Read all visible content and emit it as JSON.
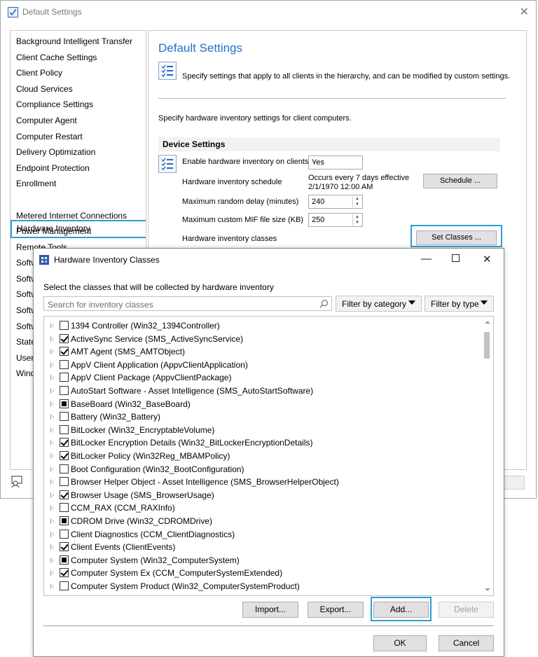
{
  "window": {
    "title": "Default Settings"
  },
  "sidebar": {
    "items": [
      "Background Intelligent Transfer",
      "Client Cache Settings",
      "Client Policy",
      "Cloud Services",
      "Compliance Settings",
      "Computer Agent",
      "Computer Restart",
      "Delivery Optimization",
      "Endpoint Protection",
      "Enrollment",
      "Hardware Inventory",
      "Metered Internet Connections",
      "Power Management",
      "Remote Tools",
      "Softw",
      "Softw",
      "Softw",
      "Softw",
      "Softw",
      "State",
      "User",
      "Wind"
    ],
    "selected": "Hardware Inventory"
  },
  "content": {
    "title": "Default Settings",
    "description": "Specify settings that apply to all clients in the hierarchy, and can be modified by custom settings.",
    "hw_description": "Specify hardware inventory settings for client computers.",
    "section": "Device Settings",
    "enable_label": "Enable hardware inventory on clients",
    "enable_value": "Yes",
    "schedule_label": "Hardware inventory schedule",
    "schedule_text_1": "Occurs every 7 days effective",
    "schedule_text_2": "2/1/1970 12:00 AM",
    "schedule_button": "Schedule ...",
    "delay_label": "Maximum random delay (minutes)",
    "delay_value": "240",
    "mif_label": "Maximum custom MIF file size (KB)",
    "mif_value": "250",
    "classes_label": "Hardware inventory classes",
    "set_classes_button": "Set Classes ..."
  },
  "dialog": {
    "title": "Hardware Inventory Classes",
    "instruction": "Select the classes that will be collected by hardware inventory",
    "search_placeholder": "Search for inventory classes",
    "filter_category": "Filter by category",
    "filter_type": "Filter by type",
    "classes": [
      {
        "label": "1394 Controller (Win32_1394Controller)",
        "state": "unchecked"
      },
      {
        "label": "ActiveSync Service (SMS_ActiveSyncService)",
        "state": "checked"
      },
      {
        "label": "AMT Agent (SMS_AMTObject)",
        "state": "checked"
      },
      {
        "label": "AppV Client Application (AppvClientApplication)",
        "state": "unchecked"
      },
      {
        "label": "AppV Client Package (AppvClientPackage)",
        "state": "unchecked"
      },
      {
        "label": "AutoStart Software - Asset Intelligence (SMS_AutoStartSoftware)",
        "state": "unchecked"
      },
      {
        "label": "BaseBoard (Win32_BaseBoard)",
        "state": "partial"
      },
      {
        "label": "Battery (Win32_Battery)",
        "state": "unchecked"
      },
      {
        "label": "BitLocker (Win32_EncryptableVolume)",
        "state": "unchecked"
      },
      {
        "label": "BitLocker Encryption Details (Win32_BitLockerEncryptionDetails)",
        "state": "checked"
      },
      {
        "label": "BitLocker Policy (Win32Reg_MBAMPolicy)",
        "state": "checked"
      },
      {
        "label": "Boot Configuration (Win32_BootConfiguration)",
        "state": "unchecked"
      },
      {
        "label": "Browser Helper Object - Asset Intelligence (SMS_BrowserHelperObject)",
        "state": "unchecked"
      },
      {
        "label": "Browser Usage (SMS_BrowserUsage)",
        "state": "checked"
      },
      {
        "label": "CCM_RAX (CCM_RAXInfo)",
        "state": "unchecked"
      },
      {
        "label": "CDROM Drive (Win32_CDROMDrive)",
        "state": "partial"
      },
      {
        "label": "Client Diagnostics (CCM_ClientDiagnostics)",
        "state": "unchecked"
      },
      {
        "label": "Client Events (ClientEvents)",
        "state": "checked"
      },
      {
        "label": "Computer System (Win32_ComputerSystem)",
        "state": "partial"
      },
      {
        "label": "Computer System Ex (CCM_ComputerSystemExtended)",
        "state": "checked"
      },
      {
        "label": "Computer System Product (Win32_ComputerSystemProduct)",
        "state": "unchecked"
      }
    ],
    "buttons": {
      "import": "Import...",
      "export": "Export...",
      "add": "Add...",
      "delete": "Delete",
      "ok": "OK",
      "cancel": "Cancel"
    }
  },
  "colors": {
    "accent": "#1e73c8",
    "highlight": "#2aa0d6"
  }
}
